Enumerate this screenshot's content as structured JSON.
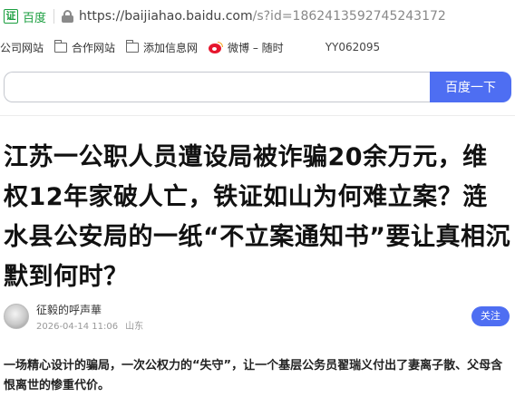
{
  "browser": {
    "security_badge": "证",
    "site_name": "百度",
    "url_main": "https://baijiahao.baidu.com",
    "url_path": "/s?id=1862413592745243172"
  },
  "bookmarks": {
    "items": [
      {
        "label": "公司网站",
        "icon": "folder-icon"
      },
      {
        "label": "合作网站",
        "icon": "folder-icon"
      },
      {
        "label": "添加信息网",
        "icon": "folder-icon"
      },
      {
        "label": "微博 – 随时",
        "icon": "weibo-icon"
      }
    ],
    "code": "YY062095"
  },
  "search": {
    "value": "",
    "button_label": "百度一下"
  },
  "article": {
    "title": "江苏一公职人员遭设局被诈骗20余万元，维权12年家破人亡，铁证如山为何难立案？涟水县公安局的一纸“不立案通知书”要让真相沉默到何时？",
    "author": {
      "name": "征毅的呼声華",
      "date": "2026-04-14 11:06",
      "location": "山东",
      "follow_label": "关注"
    },
    "body": "一场精心设计的骗局，一次公权力的“失守”，让一个基层公务员翟瑞义付出了妻离子散、父母含恨离世的惨重代价。"
  },
  "colors": {
    "accent": "#4e6ef2",
    "secure_green": "#1a9e3f"
  }
}
